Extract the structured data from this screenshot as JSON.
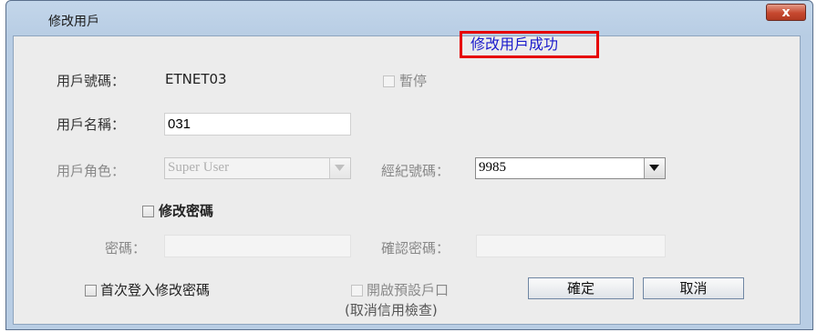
{
  "window": {
    "title": "修改用戶",
    "close_label": "x"
  },
  "user_id": {
    "label": "用戶號碼：",
    "value": "ETNET03"
  },
  "suspend": {
    "label": "暫停"
  },
  "status_message": "修改用戶成功",
  "user_name": {
    "label": "用戶名稱：",
    "value": "031"
  },
  "user_role": {
    "label": "用戶角色：",
    "value": "Super User"
  },
  "broker_no": {
    "label": "經紀號碼：",
    "value": "9985"
  },
  "change_password": {
    "label": "修改密碼"
  },
  "password": {
    "label": "密碼：",
    "value": ""
  },
  "confirm_password": {
    "label": "確認密碼：",
    "value": ""
  },
  "first_login_change": {
    "label": "首次登入修改密碼"
  },
  "open_default_account": {
    "label_line1": "開啟預設戶口",
    "label_line2": "(取消信用檢查)"
  },
  "buttons": {
    "ok": "確定",
    "cancel": "取消"
  }
}
